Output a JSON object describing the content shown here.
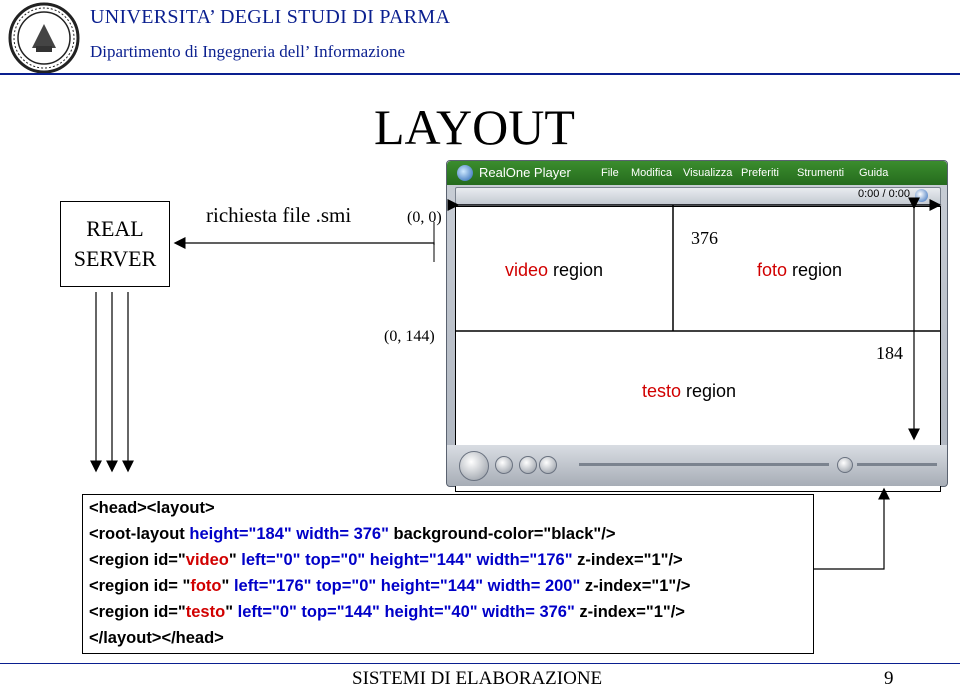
{
  "header": {
    "university": "UNIVERSITA’ DEGLI STUDI DI PARMA",
    "department": "Dipartimento di Ingegneria dell’ Informazione",
    "seal_icon": "university-seal-icon"
  },
  "slide": {
    "title": "LAYOUT"
  },
  "diagram": {
    "server_line1": "REAL",
    "server_line2": "SERVER",
    "request_label": "richiesta file .smi",
    "origin_coord": "(0, 0)",
    "testo_coord": "(0, 144)",
    "width_376": "376",
    "height_184": "184",
    "video_label_colored": "video",
    "video_label_rest": " region",
    "foto_label_colored": "foto",
    "foto_label_rest": " region",
    "testo_label_colored": "testo",
    "testo_label_rest": " region"
  },
  "player": {
    "name": "RealOne Player",
    "menu": [
      "File",
      "Modifica",
      "Visualizza",
      "Preferiti",
      "Strumenti",
      "Guida"
    ],
    "timecode": "0:00 / 0:00"
  },
  "code": {
    "line1": "<head><layout>",
    "line2_a": "<root-layout ",
    "line2_b": "height=\"184\" width= 376\"",
    "line2_c": " background-color=\"black\"/>",
    "line3_a": "<region id=\"",
    "line3_id": "video",
    "line3_b": "\" ",
    "line3_c": "left=\"0\" top=\"0\" height=\"144\" width=\"176\"",
    "line3_d": " z-index=\"1\"/>",
    "line4_a": "<region id= \"",
    "line4_id": "foto",
    "line4_b": "\" ",
    "line4_c": "left=\"176\" top=\"0\" height=\"144\" width= 200\"",
    "line4_d": " z-index=\"1\"/>",
    "line5_a": "<region id=\"",
    "line5_id": "testo",
    "line5_b": "\" ",
    "line5_c": "left=\"0\" top=\"144\" height=\"40\" width= 376\"",
    "line5_d": " z-index=\"1\"/>",
    "line6": "</layout></head>"
  },
  "footer": {
    "course": "SISTEMI DI ELABORAZIONE",
    "page": "9"
  }
}
